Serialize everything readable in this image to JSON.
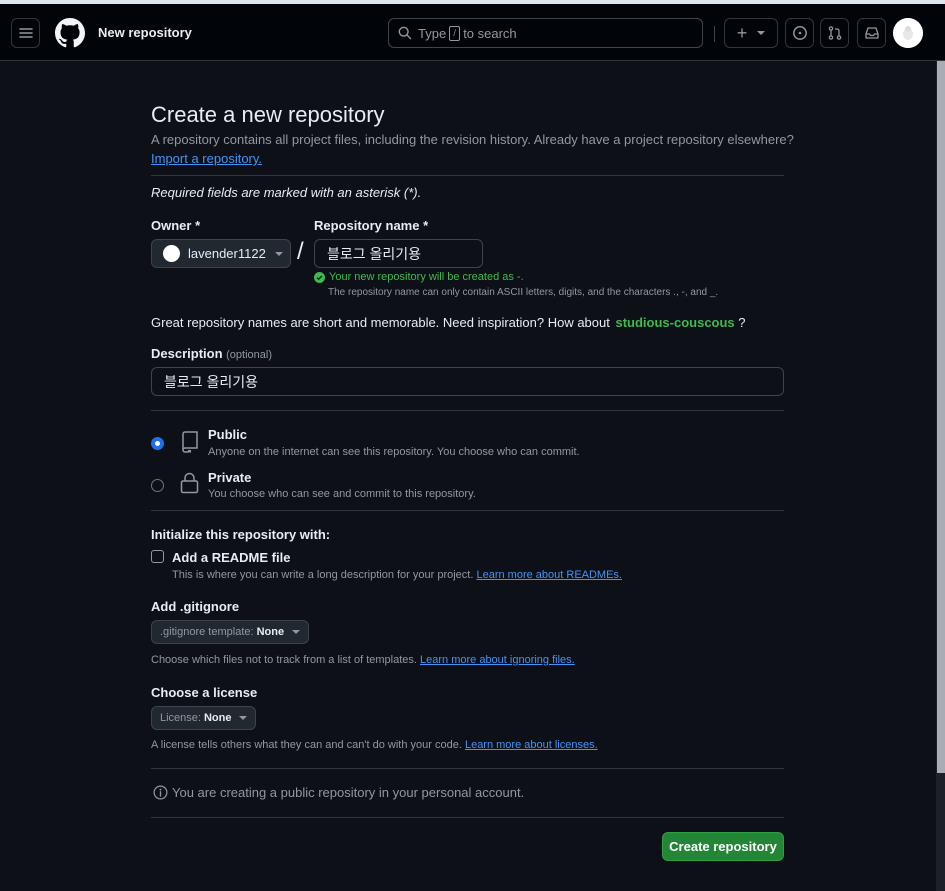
{
  "header": {
    "title": "New repository",
    "search_prefix": "Type",
    "search_key": "/",
    "search_suffix": "to search",
    "plus_label": "+"
  },
  "page": {
    "title": "Create a new repository",
    "subtitle": "A repository contains all project files, including the revision history. Already have a project repository elsewhere?",
    "import_link": "Import a repository.",
    "required_note": "Required fields are marked with an asterisk (*)."
  },
  "owner": {
    "label": "Owner *",
    "value": "lavender1122"
  },
  "repo_name": {
    "label": "Repository name *",
    "value": "블로그 올리기용",
    "valid_text": "Your new repository will be created as -.",
    "hint": "The repository name can only contain ASCII letters, digits, and the characters .,  -,  and  _."
  },
  "inspiration": {
    "text": "Great repository names are short and memorable. Need inspiration? How about",
    "suggestion": "studious-couscous",
    "end": "?"
  },
  "description": {
    "label": "Description",
    "optional": "(optional)",
    "value": "블로그 올리기용"
  },
  "visibility": {
    "public_label": "Public",
    "public_desc": "Anyone on the internet can see this repository. You choose who can commit.",
    "private_label": "Private",
    "private_desc": "You choose who can see and commit to this repository.",
    "selected": "public"
  },
  "init": {
    "heading": "Initialize this repository with:",
    "readme_label": "Add a README file",
    "readme_desc": "This is where you can write a long description for your project.",
    "readme_link": "Learn more about READMEs."
  },
  "gitignore": {
    "heading": "Add .gitignore",
    "dd_prefix": ".gitignore template:",
    "dd_value": "None",
    "desc": "Choose which files not to track from a list of templates.",
    "link": "Learn more about ignoring files."
  },
  "license": {
    "heading": "Choose a license",
    "dd_prefix": "License:",
    "dd_value": "None",
    "desc": "A license tells others what they can and can't do with your code.",
    "link": "Learn more about licenses."
  },
  "notice": "You are creating a public repository in your personal account.",
  "create_button": "Create repository",
  "colors": {
    "background": "#0d1117",
    "header": "#010409",
    "accent_link": "#4493f8",
    "success": "#3fb950",
    "primary_button": "#238636"
  }
}
